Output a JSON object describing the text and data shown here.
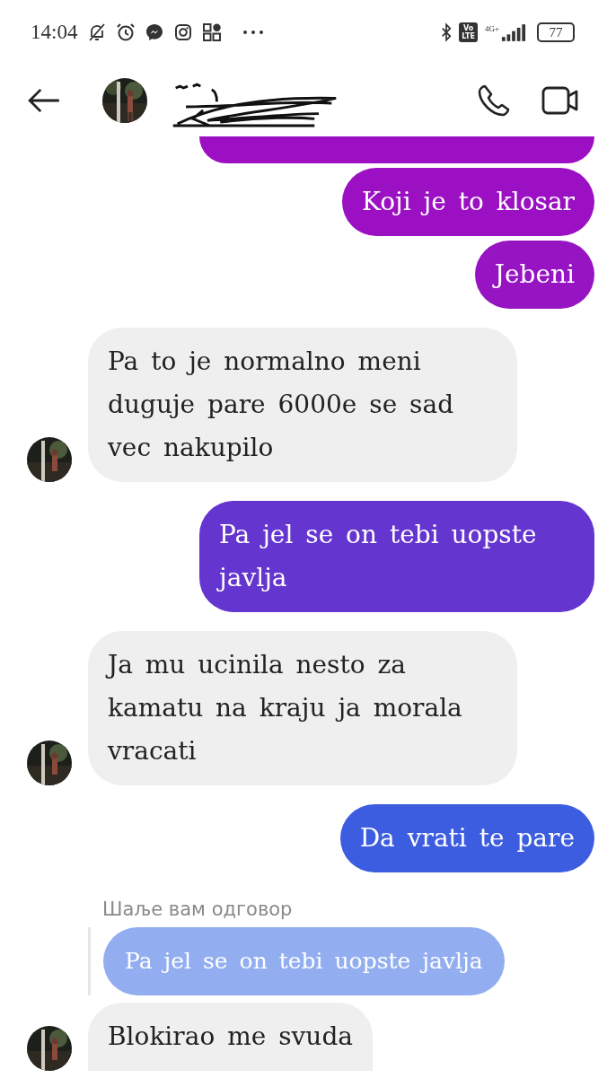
{
  "status_bar": {
    "time": "14:04",
    "volte": [
      "Vo",
      "LTE"
    ],
    "network": "4G+",
    "battery": "77"
  },
  "messages": [
    {
      "kind": "outgoing_cut",
      "color": "#9c0fc2"
    },
    {
      "kind": "outgoing",
      "text": "Koji je to klosar",
      "color": "#9a10c2"
    },
    {
      "kind": "outgoing",
      "text": "Jebeni",
      "color": "#9614c2"
    },
    {
      "kind": "incoming",
      "text": "Pa to je normalno meni duguje pare 6000e se sad vec nakupilo"
    },
    {
      "kind": "outgoing",
      "text": "Pa jel se on tebi uopste javlja",
      "color": "#6535cf"
    },
    {
      "kind": "incoming",
      "text": "Ja mu ucinila nesto za kamatu na kraju ja morala vracati"
    },
    {
      "kind": "outgoing",
      "text": "Da vrati te pare",
      "color": "#3d5de0"
    },
    {
      "kind": "incoming",
      "text": "Blokirao me svuda",
      "reply": {
        "label": "Шаље вам одговор",
        "quote": "Pa jel se on tebi uopste javlja"
      }
    }
  ]
}
